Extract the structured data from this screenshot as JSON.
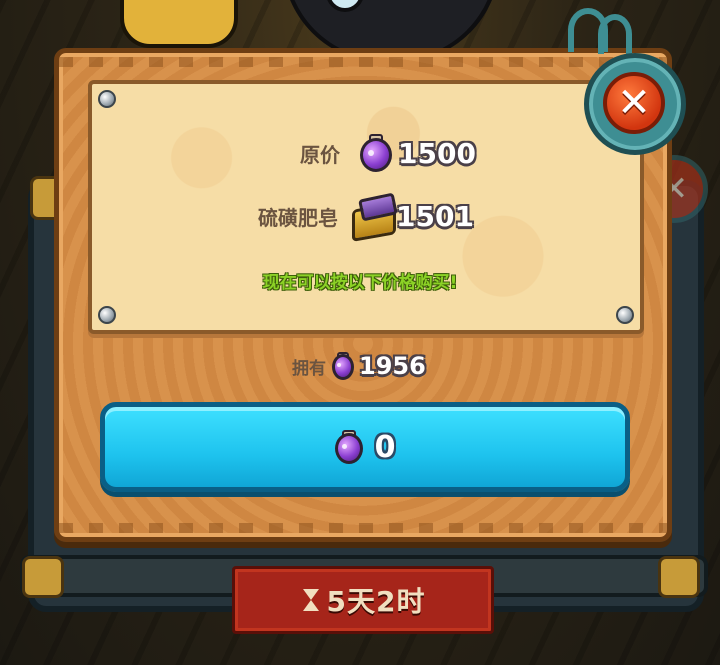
{
  "dialog": {
    "original_price_label": "原价",
    "original_price_value": "1500",
    "item_label": "硫磺肥皂",
    "item_price_value": "1501",
    "notice": "现在可以按以下价格购买!",
    "owned_label": "拥有",
    "owned_value": "1956",
    "buy_price": "0",
    "close_symbol": "✕"
  },
  "background": {
    "timer": "5天2时"
  },
  "icons": {
    "currency": "purple-potion-icon",
    "item": "sulfur-soap-chest-icon",
    "close": "close-icon",
    "timer": "hourglass-icon"
  },
  "colors": {
    "board": "#d8924c",
    "parchment": "#f6dda6",
    "buy_button": "#1ec3ee",
    "notice_text": "#8cd226",
    "close_button": "#d2350f"
  }
}
